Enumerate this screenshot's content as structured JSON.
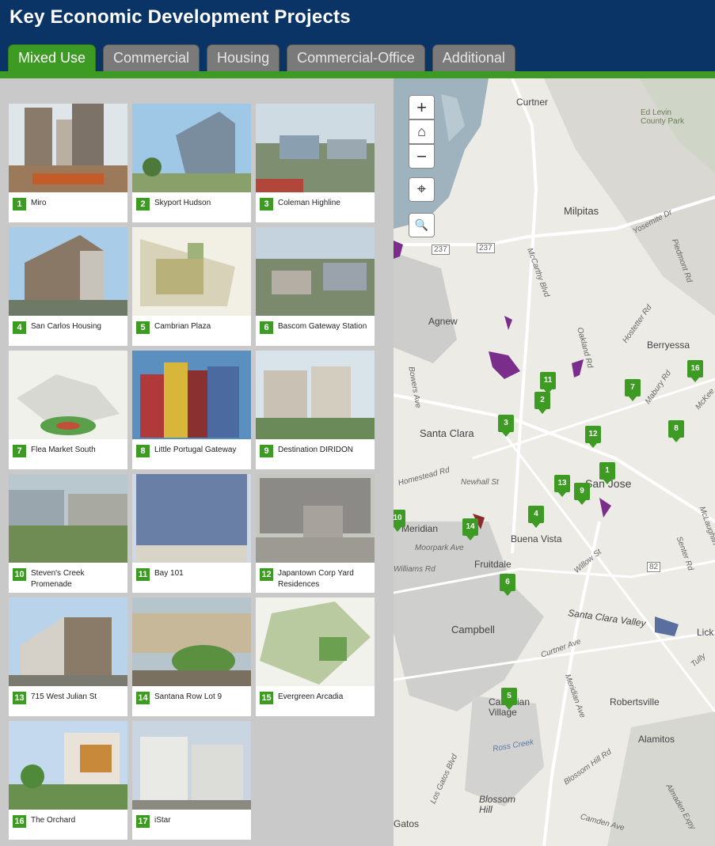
{
  "header": {
    "title": "Key Economic Development Projects"
  },
  "tabs": [
    {
      "label": "Mixed Use"
    },
    {
      "label": "Commercial"
    },
    {
      "label": "Housing"
    },
    {
      "label": "Commercial-Office"
    },
    {
      "label": "Additional"
    }
  ],
  "projects": [
    {
      "num": "1",
      "name": "Miro"
    },
    {
      "num": "2",
      "name": "Skyport Hudson"
    },
    {
      "num": "3",
      "name": "Coleman Highline"
    },
    {
      "num": "4",
      "name": "San Carlos Housing"
    },
    {
      "num": "5",
      "name": "Cambrian Plaza"
    },
    {
      "num": "6",
      "name": "Bascom Gateway Station"
    },
    {
      "num": "7",
      "name": "Flea Market South"
    },
    {
      "num": "8",
      "name": "Little Portugal Gateway"
    },
    {
      "num": "9",
      "name": "Destination DIRIDON"
    },
    {
      "num": "10",
      "name": "Steven's Creek Promenade"
    },
    {
      "num": "11",
      "name": "Bay 101"
    },
    {
      "num": "12",
      "name": "Japantown Corp Yard Residences"
    },
    {
      "num": "13",
      "name": "715 West Julian St"
    },
    {
      "num": "14",
      "name": "Santana Row Lot 9"
    },
    {
      "num": "15",
      "name": "Evergreen Arcadia"
    },
    {
      "num": "16",
      "name": "The Orchard"
    },
    {
      "num": "17",
      "name": "iStar"
    }
  ],
  "map": {
    "controls": {
      "zoom_in": "+",
      "home": "⌂",
      "zoom_out": "−",
      "locate": "⌖",
      "search": "🔍"
    },
    "places": [
      {
        "name": "Curtner"
      },
      {
        "name": "Ed Levin County Park"
      },
      {
        "name": "Milpitas"
      },
      {
        "name": "Agnew"
      },
      {
        "name": "Berryessa"
      },
      {
        "name": "Santa Clara"
      },
      {
        "name": "San Jose"
      },
      {
        "name": "Buena Vista"
      },
      {
        "name": "Meridian"
      },
      {
        "name": "Fruitdale"
      },
      {
        "name": "Campbell"
      },
      {
        "name": "Cambrian Village"
      },
      {
        "name": "Robertsville"
      },
      {
        "name": "Alamitos"
      },
      {
        "name": "Lick"
      },
      {
        "name": "Blossom Hill"
      },
      {
        "name": "Gatos"
      },
      {
        "name": "Santa Clara Valley"
      }
    ],
    "roads": [
      {
        "name": "Yosemite Dr"
      },
      {
        "name": "Piedmont Rd"
      },
      {
        "name": "McCarthy Blvd"
      },
      {
        "name": "Oakland Rd"
      },
      {
        "name": "Hostetter Rd"
      },
      {
        "name": "Mabury Rd"
      },
      {
        "name": "Bowers Ave"
      },
      {
        "name": "Homestead Rd"
      },
      {
        "name": "Newhall St"
      },
      {
        "name": "Moorpark Ave"
      },
      {
        "name": "Williams Rd"
      },
      {
        "name": "Willow St"
      },
      {
        "name": "Senter Rd"
      },
      {
        "name": "Curtner Ave"
      },
      {
        "name": "Meridian Ave"
      },
      {
        "name": "Los Gatos Blvd"
      },
      {
        "name": "Blossom Hill Rd"
      },
      {
        "name": "Camden Ave"
      },
      {
        "name": "Almaden Expy"
      },
      {
        "name": "Ross Creek"
      },
      {
        "name": "McKee"
      },
      {
        "name": "McLaughlin"
      },
      {
        "name": "Tully"
      }
    ],
    "shields": [
      {
        "name": "237"
      },
      {
        "name": "237"
      },
      {
        "name": "82"
      }
    ],
    "pins": [
      "1",
      "2",
      "3",
      "4",
      "5",
      "6",
      "7",
      "8",
      "9",
      "10",
      "11",
      "12",
      "13",
      "14",
      "16"
    ]
  }
}
